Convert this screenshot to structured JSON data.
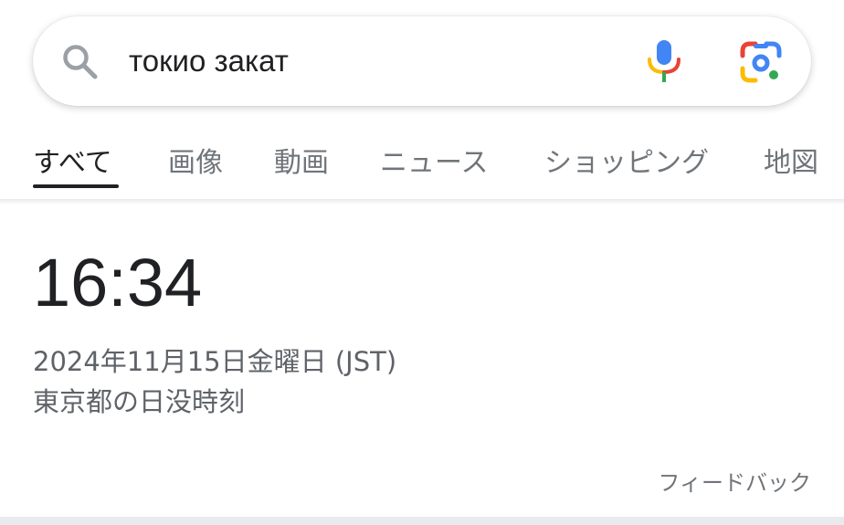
{
  "search": {
    "query": "токио закат",
    "icons": {
      "search": "search-icon",
      "voice": "microphone-icon",
      "lens": "google-lens-icon"
    }
  },
  "tabs": [
    {
      "label": "すべて",
      "active": true
    },
    {
      "label": "画像",
      "active": false
    },
    {
      "label": "動画",
      "active": false
    },
    {
      "label": "ニュース",
      "active": false
    },
    {
      "label": "ショッピング",
      "active": false
    },
    {
      "label": "地図",
      "active": false
    }
  ],
  "result": {
    "time": "16:34",
    "date": "2024年11月15日金曜日 (JST)",
    "description": "東京都の日没時刻",
    "feedback": "フィードバック"
  },
  "colors": {
    "text_primary": "#202124",
    "text_secondary": "#5f6368",
    "tab_inactive": "#70757a",
    "google_blue": "#4285f4",
    "google_red": "#ea4335",
    "google_yellow": "#fbbc04",
    "google_green": "#34a853"
  }
}
